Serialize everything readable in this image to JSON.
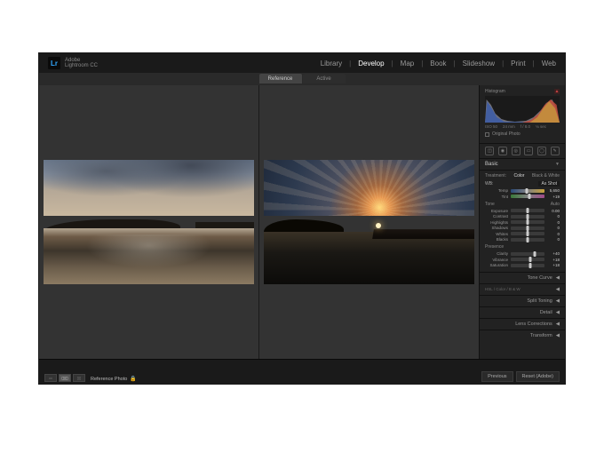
{
  "brand": {
    "logo": "Lr",
    "line1": "Adobe",
    "line2": "Lightroom CC"
  },
  "modules": [
    "Library",
    "Develop",
    "Map",
    "Book",
    "Slideshow",
    "Print",
    "Web"
  ],
  "active_module": "Develop",
  "tabs": {
    "reference": "Reference",
    "active": "Active"
  },
  "histogram": {
    "title": "Histogram",
    "iso": "ISO 50",
    "focal": "24 mm",
    "aperture": "f / 8.0",
    "shutter": "⅛ sec"
  },
  "original_photo": "Original Photo",
  "basic": {
    "title": "Basic",
    "treatment": {
      "label": "Treatment:",
      "color": "Color",
      "bw": "Black & White"
    },
    "wb": {
      "label": "WB:",
      "value": "As Shot"
    },
    "temp": {
      "label": "Temp",
      "value": "5,650"
    },
    "tint": {
      "label": "Tint",
      "value": "+19"
    },
    "tone": "Tone",
    "auto": "Auto",
    "exposure": {
      "label": "Exposure",
      "value": "0.00",
      "pos": 50
    },
    "contrast": {
      "label": "Contrast",
      "value": "0",
      "pos": 50
    },
    "highlights": {
      "label": "Highlights",
      "value": "0",
      "pos": 50
    },
    "shadows": {
      "label": "Shadows",
      "value": "0",
      "pos": 50
    },
    "whites": {
      "label": "Whites",
      "value": "0",
      "pos": 50
    },
    "blacks": {
      "label": "Blacks",
      "value": "0",
      "pos": 50
    },
    "presence": "Presence",
    "clarity": {
      "label": "Clarity",
      "value": "+40",
      "pos": 70
    },
    "vibrance": {
      "label": "Vibrance",
      "value": "+18",
      "pos": 59
    },
    "saturation": {
      "label": "Saturation",
      "value": "+18",
      "pos": 59
    }
  },
  "panels": {
    "tonecurve": "Tone Curve",
    "hsl": "HSL",
    "hslsub": "Color / B & W",
    "split": "Split Toning",
    "detail": "Detail",
    "lens": "Lens Corrections",
    "transform": "Transform"
  },
  "bottom": {
    "refphoto": "Reference Photo",
    "previous": "Previous",
    "reset": "Reset (Adobe)"
  }
}
